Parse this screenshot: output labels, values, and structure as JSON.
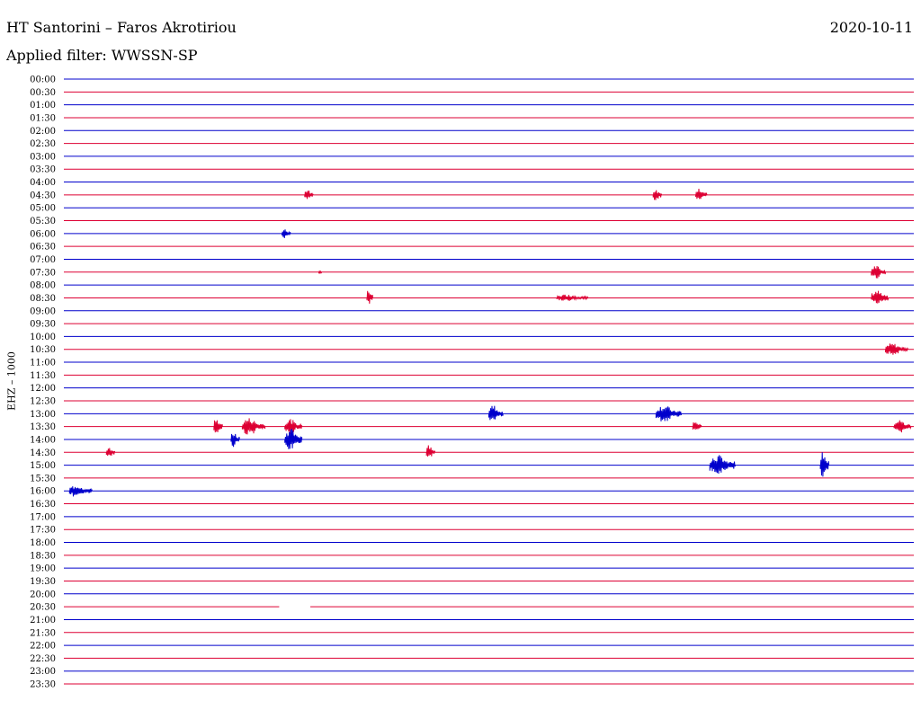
{
  "header": {
    "station": "HT Santorini – Faros Akrotiriou",
    "date": "2020-10-11",
    "filter": "Applied filter: WWSSN-SP"
  },
  "chart_data": {
    "type": "line",
    "ylabel": "EHZ – 1000",
    "row_colors": [
      "#0000cc",
      "#dd0033"
    ],
    "ticks": [
      "00:00",
      "00:30",
      "01:00",
      "01:30",
      "02:00",
      "02:30",
      "03:00",
      "03:30",
      "04:00",
      "04:30",
      "05:00",
      "05:30",
      "06:00",
      "06:30",
      "07:00",
      "07:30",
      "08:00",
      "08:30",
      "09:00",
      "09:30",
      "10:00",
      "10:30",
      "11:00",
      "11:30",
      "12:00",
      "12:30",
      "13:00",
      "13:30",
      "14:00",
      "14:30",
      "15:00",
      "15:30",
      "16:00",
      "16:30",
      "17:00",
      "17:30",
      "18:00",
      "18:30",
      "19:00",
      "19:30",
      "20:00",
      "20:30",
      "21:00",
      "21:30",
      "22:00",
      "22:30",
      "23:00",
      "23:30"
    ],
    "minutes_per_line": 30,
    "events": [
      {
        "row": 9,
        "minute": 8.5,
        "duration": 0.3,
        "amplitude": 7
      },
      {
        "row": 9,
        "minute": 20.8,
        "duration": 0.3,
        "amplitude": 8
      },
      {
        "row": 9,
        "minute": 22.3,
        "duration": 0.4,
        "amplitude": 7
      },
      {
        "row": 12,
        "minute": 7.7,
        "duration": 0.3,
        "amplitude": 6
      },
      {
        "row": 15,
        "minute": 9.0,
        "duration": 0.1,
        "amplitude": 3
      },
      {
        "row": 15,
        "minute": 28.5,
        "duration": 0.5,
        "amplitude": 8
      },
      {
        "row": 17,
        "minute": 10.7,
        "duration": 0.2,
        "amplitude": 10
      },
      {
        "row": 17,
        "minute": 17.4,
        "duration": 1.1,
        "amplitude": 4
      },
      {
        "row": 17,
        "minute": 28.5,
        "duration": 0.6,
        "amplitude": 9
      },
      {
        "row": 21,
        "minute": 29.0,
        "duration": 0.8,
        "amplitude": 7
      },
      {
        "row": 26,
        "minute": 15.0,
        "duration": 0.5,
        "amplitude": 10
      },
      {
        "row": 26,
        "minute": 20.9,
        "duration": 0.9,
        "amplitude": 10
      },
      {
        "row": 27,
        "minute": 5.3,
        "duration": 0.3,
        "amplitude": 10
      },
      {
        "row": 27,
        "minute": 6.3,
        "duration": 0.8,
        "amplitude": 10
      },
      {
        "row": 27,
        "minute": 7.8,
        "duration": 0.6,
        "amplitude": 9
      },
      {
        "row": 27,
        "minute": 22.2,
        "duration": 0.3,
        "amplitude": 8
      },
      {
        "row": 27,
        "minute": 29.3,
        "duration": 0.6,
        "amplitude": 8
      },
      {
        "row": 28,
        "minute": 5.9,
        "duration": 0.3,
        "amplitude": 10
      },
      {
        "row": 28,
        "minute": 7.8,
        "duration": 0.6,
        "amplitude": 13
      },
      {
        "row": 29,
        "minute": 1.5,
        "duration": 0.3,
        "amplitude": 7
      },
      {
        "row": 29,
        "minute": 12.8,
        "duration": 0.3,
        "amplitude": 9
      },
      {
        "row": 30,
        "minute": 22.8,
        "duration": 0.9,
        "amplitude": 12
      },
      {
        "row": 30,
        "minute": 26.7,
        "duration": 0.3,
        "amplitude": 15
      },
      {
        "row": 32,
        "minute": 0.2,
        "duration": 0.8,
        "amplitude": 7
      }
    ],
    "gaps": [
      {
        "row": 41,
        "minute": 7.6,
        "duration": 1.1
      }
    ]
  }
}
